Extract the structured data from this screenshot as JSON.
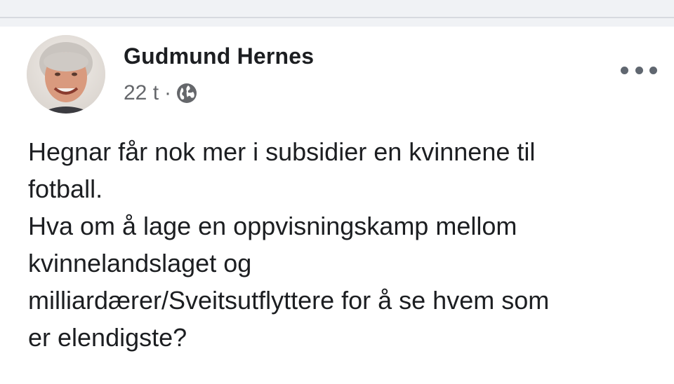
{
  "post": {
    "author": "Gudmund Hernes",
    "timestamp": "22 t",
    "separator": "·",
    "audience_icon": "globe-icon",
    "more_icon": "more-horizontal-icon",
    "text_lines": [
      "Hegnar får nok mer i subsidier en kvinnene til",
      "fotball.",
      "Hva om å lage en oppvisningskamp mellom",
      "kvinnelandslaget og",
      "milliardærer/Sveitsutflyttere for å se hvem som",
      "er elendigste?"
    ]
  },
  "colors": {
    "background": "#f0f2f5",
    "card": "#ffffff",
    "name_text": "#1c1e21",
    "meta_text": "#65676b",
    "icon": "#606770"
  }
}
